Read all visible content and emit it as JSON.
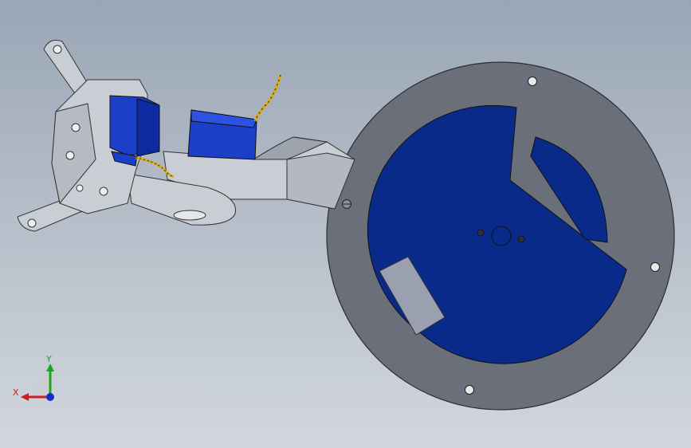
{
  "viewport": {
    "background_top": "#9aa6b6",
    "background_bottom": "#d2d7dd"
  },
  "model": {
    "metal_color": "#c9cdd4",
    "metal_shade": "#9ea4ad",
    "plate_color": "#6a6f7a",
    "disc_color": "#0a2a8a",
    "servo_color": "#1d3fc8",
    "wire_color": "#d8a820",
    "pad_color": "#9aa0b0"
  },
  "triad": {
    "x_label": "X",
    "y_label": "Y",
    "x_color": "#d11a1a",
    "y_color": "#1aa81a",
    "z_color": "#1a2ad1"
  }
}
